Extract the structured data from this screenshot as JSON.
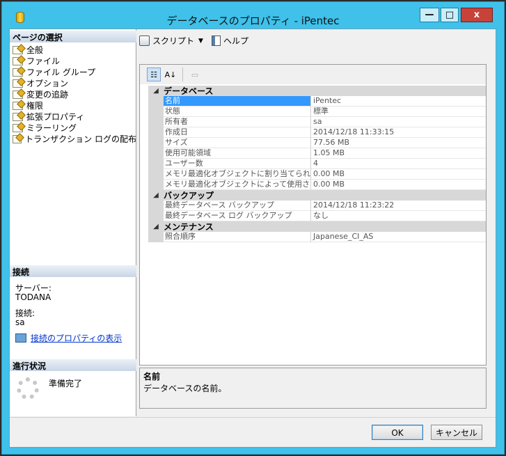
{
  "window": {
    "title": "データベースのプロパティ - iPentec",
    "minimize": "—",
    "maximize": "□",
    "close": "x"
  },
  "left": {
    "pages_header": "ページの選択",
    "pages": [
      "全般",
      "ファイル",
      "ファイル グループ",
      "オプション",
      "変更の追跡",
      "権限",
      "拡張プロパティ",
      "ミラーリング",
      "トランザクション ログの配布"
    ],
    "connection_header": "接続",
    "server_label": "サーバー:",
    "server_value": "TODANA",
    "connection_label": "接続:",
    "connection_value": "sa",
    "connection_link": "接続のプロパティの表示",
    "progress_header": "進行状況",
    "progress_status": "準備完了"
  },
  "toolbar": {
    "script_label": "スクリプト",
    "help_label": "ヘルプ"
  },
  "grid": {
    "categories": [
      {
        "name": "データベース",
        "rows": [
          {
            "name": "名前",
            "value": "iPentec"
          },
          {
            "name": "状態",
            "value": "標準"
          },
          {
            "name": "所有者",
            "value": "sa"
          },
          {
            "name": "作成日",
            "value": "2014/12/18 11:33:15"
          },
          {
            "name": "サイズ",
            "value": "77.56 MB"
          },
          {
            "name": "使用可能領域",
            "value": "1.05 MB"
          },
          {
            "name": "ユーザー数",
            "value": "4"
          },
          {
            "name": "メモリ最適化オブジェクトに割り当てられたメモ!",
            "value": "0.00 MB"
          },
          {
            "name": "メモリ最適化オブジェクトによって使用されるメ:",
            "value": "0.00 MB"
          }
        ]
      },
      {
        "name": "バックアップ",
        "rows": [
          {
            "name": "最終データベース バックアップ",
            "value": "2014/12/18 11:23:22"
          },
          {
            "name": "最終データベース ログ バックアップ",
            "value": "なし"
          }
        ]
      },
      {
        "name": "メンテナンス",
        "rows": [
          {
            "name": "照合順序",
            "value": "Japanese_CI_AS"
          }
        ]
      }
    ]
  },
  "description": {
    "title": "名前",
    "text": "データベースの名前。"
  },
  "buttons": {
    "ok": "OK",
    "cancel": "キャンセル"
  }
}
